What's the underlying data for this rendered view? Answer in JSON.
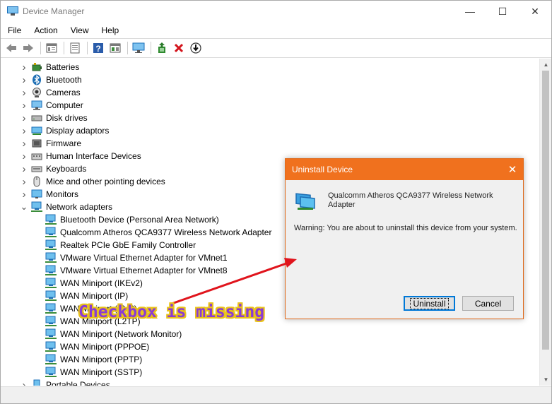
{
  "window": {
    "title": "Device Manager",
    "minimize": "—",
    "maximize": "☐",
    "close": "✕"
  },
  "menu": [
    "File",
    "Action",
    "View",
    "Help"
  ],
  "toolbar_icons": [
    "back-icon",
    "forward-icon",
    "show-hide-icon",
    "properties-icon",
    "help-icon",
    "view-icon",
    "monitor-icon",
    "update-driver-icon",
    "uninstall-icon",
    "download-icon"
  ],
  "tree": {
    "categories_top": [
      {
        "label": "Batteries",
        "icon": "battery-icon"
      },
      {
        "label": "Bluetooth",
        "icon": "bluetooth-icon"
      },
      {
        "label": "Cameras",
        "icon": "camera-icon"
      },
      {
        "label": "Computer",
        "icon": "computer-icon"
      },
      {
        "label": "Disk drives",
        "icon": "disk-icon"
      },
      {
        "label": "Display adaptors",
        "icon": "display-icon"
      },
      {
        "label": "Firmware",
        "icon": "firmware-icon"
      },
      {
        "label": "Human Interface Devices",
        "icon": "hid-icon"
      },
      {
        "label": "Keyboards",
        "icon": "keyboard-icon"
      },
      {
        "label": "Mice and other pointing devices",
        "icon": "mouse-icon"
      },
      {
        "label": "Monitors",
        "icon": "monitor-icon"
      }
    ],
    "network_adapters": {
      "label": "Network adapters",
      "children": [
        "Bluetooth Device (Personal Area Network)",
        "Qualcomm Atheros QCA9377 Wireless Network Adapter",
        "Realtek PCIe GbE Family Controller",
        "VMware Virtual Ethernet Adapter for VMnet1",
        "VMware Virtual Ethernet Adapter for VMnet8",
        "WAN Miniport (IKEv2)",
        "WAN Miniport (IP)",
        "WAN Miniport (IPv6)",
        "WAN Miniport (L2TP)",
        "WAN Miniport (Network Monitor)",
        "WAN Miniport (PPPOE)",
        "WAN Miniport (PPTP)",
        "WAN Miniport (SSTP)"
      ]
    },
    "categories_bottom": [
      {
        "label": "Portable Devices",
        "icon": "portable-icon"
      }
    ]
  },
  "dialog": {
    "title": "Uninstall Device",
    "close": "✕",
    "device_name": "Qualcomm Atheros QCA9377 Wireless Network Adapter",
    "warning": "Warning: You are about to uninstall this device from your system.",
    "uninstall_label": "Uninstall",
    "cancel_label": "Cancel"
  },
  "annotation": {
    "text": "Checkbox is missing",
    "arrow_color": "#e0141c"
  },
  "colors": {
    "dialog_title_bg": "#f0711e",
    "accent": "#0078d7"
  }
}
